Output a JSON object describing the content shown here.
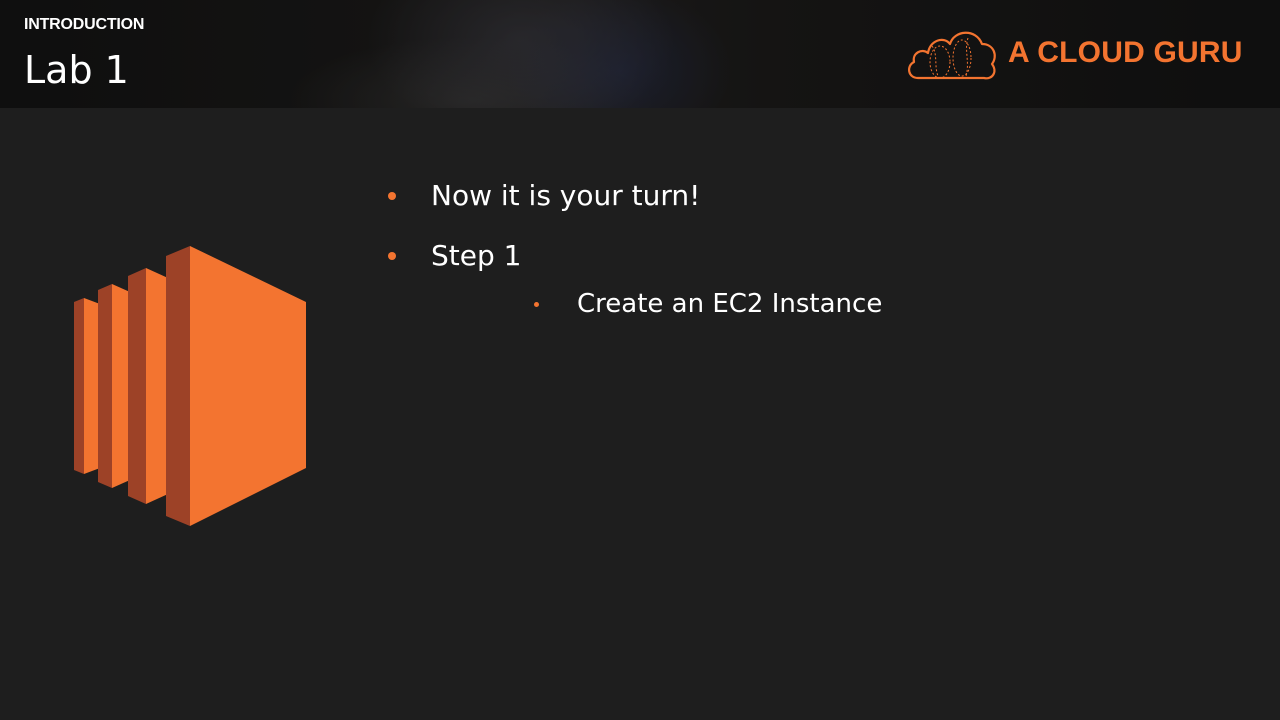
{
  "header": {
    "section_label": "INTRODUCTION",
    "title": "Lab 1"
  },
  "brand": {
    "name": "A CLOUD GURU",
    "logo_icon": "cloud-logo-icon",
    "color": "#f37430"
  },
  "graphic": {
    "icon": "ec2-instance-icon",
    "color_front": "#f37430",
    "color_side": "#9d4227"
  },
  "bullets": [
    {
      "text": "Now it is your turn!"
    },
    {
      "text": "Step 1",
      "children": [
        {
          "text": "Create an EC2 Instance"
        }
      ]
    }
  ],
  "colors": {
    "background": "#1e1e1e",
    "accent": "#f37430",
    "text": "#ffffff"
  }
}
